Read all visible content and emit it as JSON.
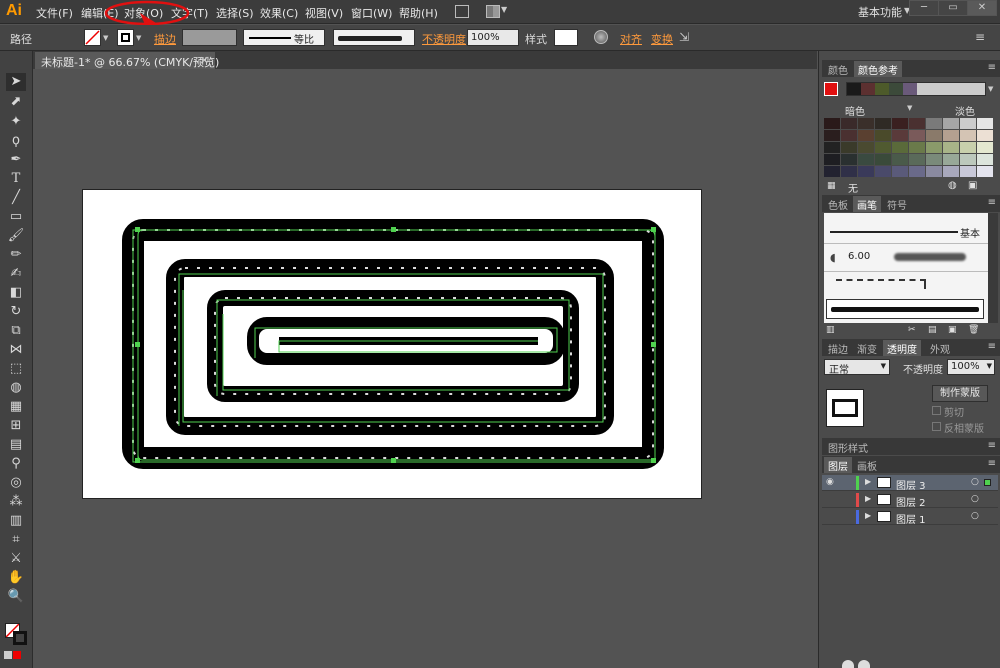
{
  "app": {
    "logo": "Ai",
    "workspace": "基本功能"
  },
  "menus": [
    "文件(F)",
    "编辑(E)",
    "对象(O)",
    "文字(T)",
    "选择(S)",
    "效果(C)",
    "视图(V)",
    "窗口(W)",
    "帮助(H)"
  ],
  "control_bar": {
    "path_label": "路径",
    "stroke_label": "描边",
    "profile_label": "等比",
    "opacity_label": "不透明度",
    "opacity_value": "100%",
    "style_label": "样式",
    "align_label": "对齐",
    "transform_label": "变换"
  },
  "document_tab": {
    "title": "未标题-1* @ 66.67% (CMYK/预览)"
  },
  "color_panel": {
    "tabs": [
      "颜色",
      "颜色参考"
    ],
    "dark_label": "暗色",
    "light_label": "淡色",
    "none_label": "无",
    "harmony_colors": [
      "#1a1a1a",
      "#5c3030",
      "#4d5a2a",
      "#3c4a3a",
      "#6a5a7a"
    ],
    "grid_colors": [
      [
        "#2a1a1a",
        "#3a2a2a",
        "#3a2f2a",
        "#2f2a25",
        "#3a2020",
        "#4a3030",
        "#7a7a7a",
        "#a6a6a6",
        "#cccccc",
        "#e6e6e6"
      ],
      [
        "#2a1e1e",
        "#4a3030",
        "#5a4030",
        "#4a4a2a",
        "#5a3a3a",
        "#7a5a5a",
        "#8a7a6a",
        "#b4a090",
        "#d4c4b4",
        "#ece0d4"
      ],
      [
        "#222222",
        "#3a3a2a",
        "#4a4a30",
        "#505a30",
        "#5a6a3a",
        "#6a7a4a",
        "#8a9a6a",
        "#a8b488",
        "#c8d0ac",
        "#e4e8d0"
      ],
      [
        "#1e1e22",
        "#2a3030",
        "#3a4a40",
        "#3a4a3a",
        "#4a5a4a",
        "#5a6a5a",
        "#7a8a7a",
        "#98a898",
        "#bcc8bc",
        "#dce4dc"
      ],
      [
        "#222230",
        "#303048",
        "#3a3a5a",
        "#4a4a6a",
        "#5a5a7a",
        "#6a6a8a",
        "#8a8aa0",
        "#a8a8bc",
        "#c8c8d8",
        "#e4e4ee"
      ]
    ]
  },
  "brush_panel": {
    "tabs": [
      "色板",
      "画笔",
      "符号"
    ],
    "basic_label": "基本",
    "size_value": "6.00"
  },
  "transparency_panel": {
    "tabs": [
      "描边",
      "渐变",
      "透明度",
      "外观"
    ],
    "blend_mode": "正常",
    "opacity_label": "不透明度",
    "opacity_value": "100%",
    "make_mask_button": "制作蒙版",
    "clip_label": "剪切",
    "invert_label": "反相蒙版"
  },
  "graphic_styles": {
    "tab": "图形样式"
  },
  "layers_panel": {
    "tabs": [
      "图层",
      "画板"
    ],
    "layers": [
      {
        "name": "图层 3",
        "color": "#4fd14f"
      },
      {
        "name": "图层 2",
        "color": "#e04a4a"
      },
      {
        "name": "图层 1",
        "color": "#4a6ae0"
      }
    ]
  },
  "annotation": {
    "color": "#e01010"
  }
}
